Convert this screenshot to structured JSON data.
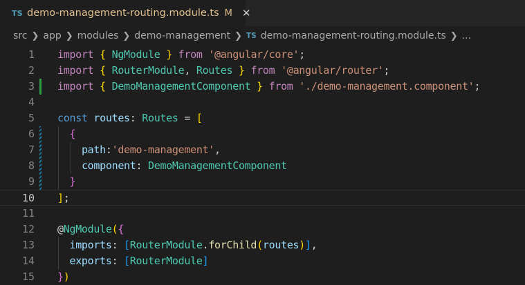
{
  "tab": {
    "lang_badge": "TS",
    "title": "demo-management-routing.module.ts",
    "status": "M",
    "close": "✕"
  },
  "breadcrumb": {
    "items": [
      "src",
      "app",
      "modules",
      "demo-management"
    ],
    "file_badge": "TS",
    "file": "demo-management-routing.module.ts",
    "ellipsis": "..."
  },
  "lines": [
    {
      "n": "1",
      "tokens": [
        [
          "kw2",
          "import"
        ],
        [
          "pl",
          " "
        ],
        [
          "br1",
          "{"
        ],
        [
          "pl",
          " "
        ],
        [
          "ty",
          "NgModule"
        ],
        [
          "pl",
          " "
        ],
        [
          "br1",
          "}"
        ],
        [
          "pl",
          " "
        ],
        [
          "kw2",
          "from"
        ],
        [
          "pl",
          " "
        ],
        [
          "str",
          "'@angular/core'"
        ],
        [
          "pl",
          ";"
        ]
      ]
    },
    {
      "n": "2",
      "tokens": [
        [
          "kw2",
          "import"
        ],
        [
          "pl",
          " "
        ],
        [
          "br1",
          "{"
        ],
        [
          "pl",
          " "
        ],
        [
          "ty",
          "RouterModule"
        ],
        [
          "pl",
          ", "
        ],
        [
          "ty",
          "Routes"
        ],
        [
          "pl",
          " "
        ],
        [
          "br1",
          "}"
        ],
        [
          "pl",
          " "
        ],
        [
          "kw2",
          "from"
        ],
        [
          "pl",
          " "
        ],
        [
          "str",
          "'@angular/router'"
        ],
        [
          "pl",
          ";"
        ]
      ]
    },
    {
      "n": "3",
      "tokens": [
        [
          "kw2",
          "import"
        ],
        [
          "pl",
          " "
        ],
        [
          "br1",
          "{"
        ],
        [
          "pl",
          " "
        ],
        [
          "ty",
          "DemoManagementComponent"
        ],
        [
          "pl",
          " "
        ],
        [
          "br1",
          "}"
        ],
        [
          "pl",
          " "
        ],
        [
          "kw2",
          "from"
        ],
        [
          "pl",
          " "
        ],
        [
          "str",
          "'./demo-management.component'"
        ],
        [
          "pl",
          ";"
        ]
      ]
    },
    {
      "n": "4",
      "tokens": []
    },
    {
      "n": "5",
      "tokens": [
        [
          "kw",
          "const"
        ],
        [
          "pl",
          " "
        ],
        [
          "var",
          "routes"
        ],
        [
          "pl",
          ": "
        ],
        [
          "ty",
          "Routes"
        ],
        [
          "pl",
          " = "
        ],
        [
          "br1",
          "["
        ]
      ]
    },
    {
      "n": "6",
      "tokens": [
        [
          "pl",
          "  "
        ],
        [
          "br2",
          "{"
        ]
      ]
    },
    {
      "n": "7",
      "tokens": [
        [
          "pl",
          "    "
        ],
        [
          "var",
          "path"
        ],
        [
          "pl",
          ":"
        ],
        [
          "str",
          "'demo-management'"
        ],
        [
          "pl",
          ","
        ]
      ]
    },
    {
      "n": "8",
      "tokens": [
        [
          "pl",
          "    "
        ],
        [
          "var",
          "component"
        ],
        [
          "pl",
          ": "
        ],
        [
          "ty",
          "DemoManagementComponent"
        ]
      ]
    },
    {
      "n": "9",
      "tokens": [
        [
          "pl",
          "  "
        ],
        [
          "br2",
          "}"
        ]
      ]
    },
    {
      "n": "10",
      "tokens": [
        [
          "br1",
          "]"
        ],
        [
          "pl",
          ";"
        ]
      ]
    },
    {
      "n": "11",
      "tokens": []
    },
    {
      "n": "12",
      "tokens": [
        [
          "pl",
          "@"
        ],
        [
          "ty",
          "NgModule"
        ],
        [
          "br1",
          "("
        ],
        [
          "br2",
          "{"
        ]
      ]
    },
    {
      "n": "13",
      "tokens": [
        [
          "pl",
          "  "
        ],
        [
          "var",
          "imports"
        ],
        [
          "pl",
          ": "
        ],
        [
          "br3",
          "["
        ],
        [
          "ty",
          "RouterModule"
        ],
        [
          "pl",
          "."
        ],
        [
          "fn",
          "forChild"
        ],
        [
          "br1",
          "("
        ],
        [
          "var",
          "routes"
        ],
        [
          "br1",
          ")"
        ],
        [
          "br3",
          "]"
        ],
        [
          "pl",
          ","
        ]
      ]
    },
    {
      "n": "14",
      "tokens": [
        [
          "pl",
          "  "
        ],
        [
          "var",
          "exports"
        ],
        [
          "pl",
          ": "
        ],
        [
          "br3",
          "["
        ],
        [
          "ty",
          "RouterModule"
        ],
        [
          "br3",
          "]"
        ]
      ]
    },
    {
      "n": "15",
      "tokens": [
        [
          "br2",
          "}"
        ],
        [
          "br1",
          ")"
        ]
      ]
    }
  ],
  "active_line": "10",
  "colors": {
    "modified_gutter": "#2ea043",
    "added_gutter": "#1b81a8"
  }
}
